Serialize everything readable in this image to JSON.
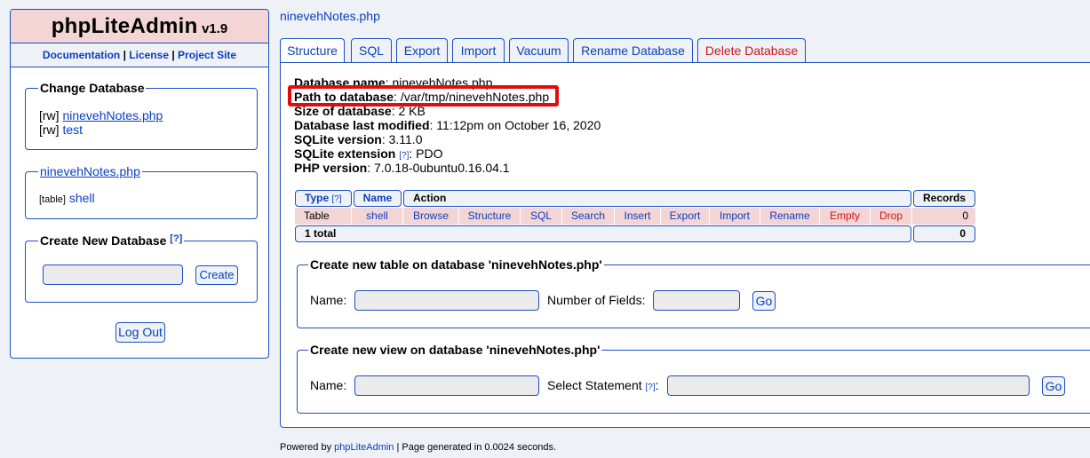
{
  "sidebar": {
    "app_name": "phpLiteAdmin",
    "version": "v1.9",
    "links": [
      "Documentation",
      "License",
      "Project Site"
    ],
    "link_sep": "|",
    "change_db": {
      "legend": "Change Database",
      "items": [
        {
          "mode": "[rw]",
          "name": "ninevehNotes.php"
        },
        {
          "mode": "[rw]",
          "name": "test"
        }
      ]
    },
    "current_db": {
      "legend": "ninevehNotes.php",
      "items": [
        {
          "type": "[table]",
          "name": "shell"
        }
      ]
    },
    "create_db": {
      "legend": "Create New Database",
      "help": "[?]",
      "value": "",
      "button": "Create"
    },
    "logout": "Log Out"
  },
  "main": {
    "db_title": "ninevehNotes.php",
    "tabs": [
      "Structure",
      "SQL",
      "Export",
      "Import",
      "Vacuum",
      "Rename Database",
      "Delete Database"
    ],
    "info": {
      "name_label": "Database name",
      "name_value": "ninevehNotes.php",
      "path_label": "Path to database",
      "path_value": "/var/tmp/ninevehNotes.php",
      "size_label": "Size of database",
      "size_value": "2 KB",
      "modified_label": "Database last modified",
      "modified_value": "11:12pm on October 16, 2020",
      "sqlite_version_label": "SQLite version",
      "sqlite_version_value": "3.11.0",
      "sqlite_ext_label": "SQLite extension",
      "sqlite_ext_help": "[?]",
      "sqlite_ext_value": "PDO",
      "php_label": "PHP version",
      "php_value": "7.0.18-0ubuntu0.16.04.1"
    },
    "table": {
      "headers": {
        "type": "Type",
        "type_help": "[?]",
        "name": "Name",
        "action": "Action",
        "records": "Records"
      },
      "row": {
        "type": "Table",
        "name": "shell",
        "records": "0"
      },
      "actions": [
        "Browse",
        "Structure",
        "SQL",
        "Search",
        "Insert",
        "Export",
        "Import",
        "Rename",
        "Empty",
        "Drop"
      ],
      "total_label": "1 total",
      "total_records": "0"
    },
    "create_table": {
      "legend": "Create new table on database 'ninevehNotes.php'",
      "name_label": "Name:",
      "fields_label": "Number of Fields:",
      "go": "Go"
    },
    "create_view": {
      "legend": "Create new view on database 'ninevehNotes.php'",
      "name_label": "Name:",
      "statement_label": "Select Statement",
      "statement_help": "[?]",
      "statement_colon": ":",
      "go": "Go"
    },
    "footer": {
      "prefix": "Powered by ",
      "link": "phpLiteAdmin",
      "suffix": " | Page generated in 0.0024 seconds."
    }
  },
  "colors": {
    "accent": "#1c4fc4",
    "link": "#0b3ebf",
    "danger": "#d0141a",
    "header_bg": "#f3d5d5",
    "highlight": "#e30c0c"
  }
}
